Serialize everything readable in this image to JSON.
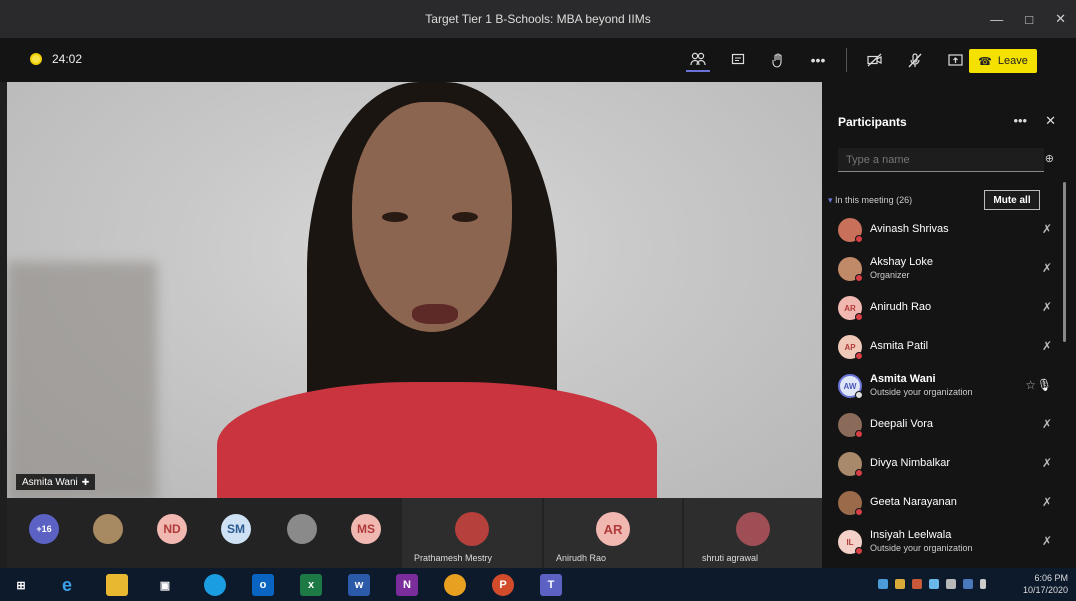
{
  "window": {
    "title": "Target Tier 1 B-Schools: MBA beyond IIMs",
    "min": "—",
    "max": "□",
    "close": "✕"
  },
  "toolbar": {
    "timer": "24:02",
    "leave_label": "Leave",
    "more": "•••"
  },
  "stage": {
    "speaker_name": "Asmita Wani"
  },
  "strip": {
    "overflow": "+16",
    "avatars": [
      "ND",
      "SM",
      "MS"
    ],
    "tiles": [
      {
        "name": "Prathamesh Mestry"
      },
      {
        "name": "Anirudh Rao",
        "initials": "AR"
      },
      {
        "name": "shruti agrawal"
      }
    ]
  },
  "panel": {
    "title": "Participants",
    "more": "•••",
    "close": "✕",
    "search_placeholder": "Type a name",
    "section": "In this meeting (26)",
    "mute_all": "Mute all",
    "participants": [
      {
        "name": "Avinash Shrivas",
        "sub": "",
        "initials": ""
      },
      {
        "name": "Akshay Loke",
        "sub": "Organizer",
        "initials": ""
      },
      {
        "name": "Anirudh Rao",
        "sub": "",
        "initials": "AR"
      },
      {
        "name": "Asmita Patil",
        "sub": "",
        "initials": "AP"
      },
      {
        "name": "Asmita Wani",
        "sub": "Outside your organization",
        "initials": "AW"
      },
      {
        "name": "Deepali Vora",
        "sub": "",
        "initials": ""
      },
      {
        "name": "Divya Nimbalkar",
        "sub": "",
        "initials": ""
      },
      {
        "name": "Geeta Narayanan",
        "sub": "",
        "initials": ""
      },
      {
        "name": "Insiyah Leelwala",
        "sub": "Outside your organization",
        "initials": "IL"
      }
    ]
  },
  "taskbar": {
    "time": "6:06 PM",
    "date": "10/17/2020"
  },
  "colors": {
    "accent": "#6b74d6",
    "leave": "#f5e100",
    "mic_off_badge": "#d73f45"
  }
}
